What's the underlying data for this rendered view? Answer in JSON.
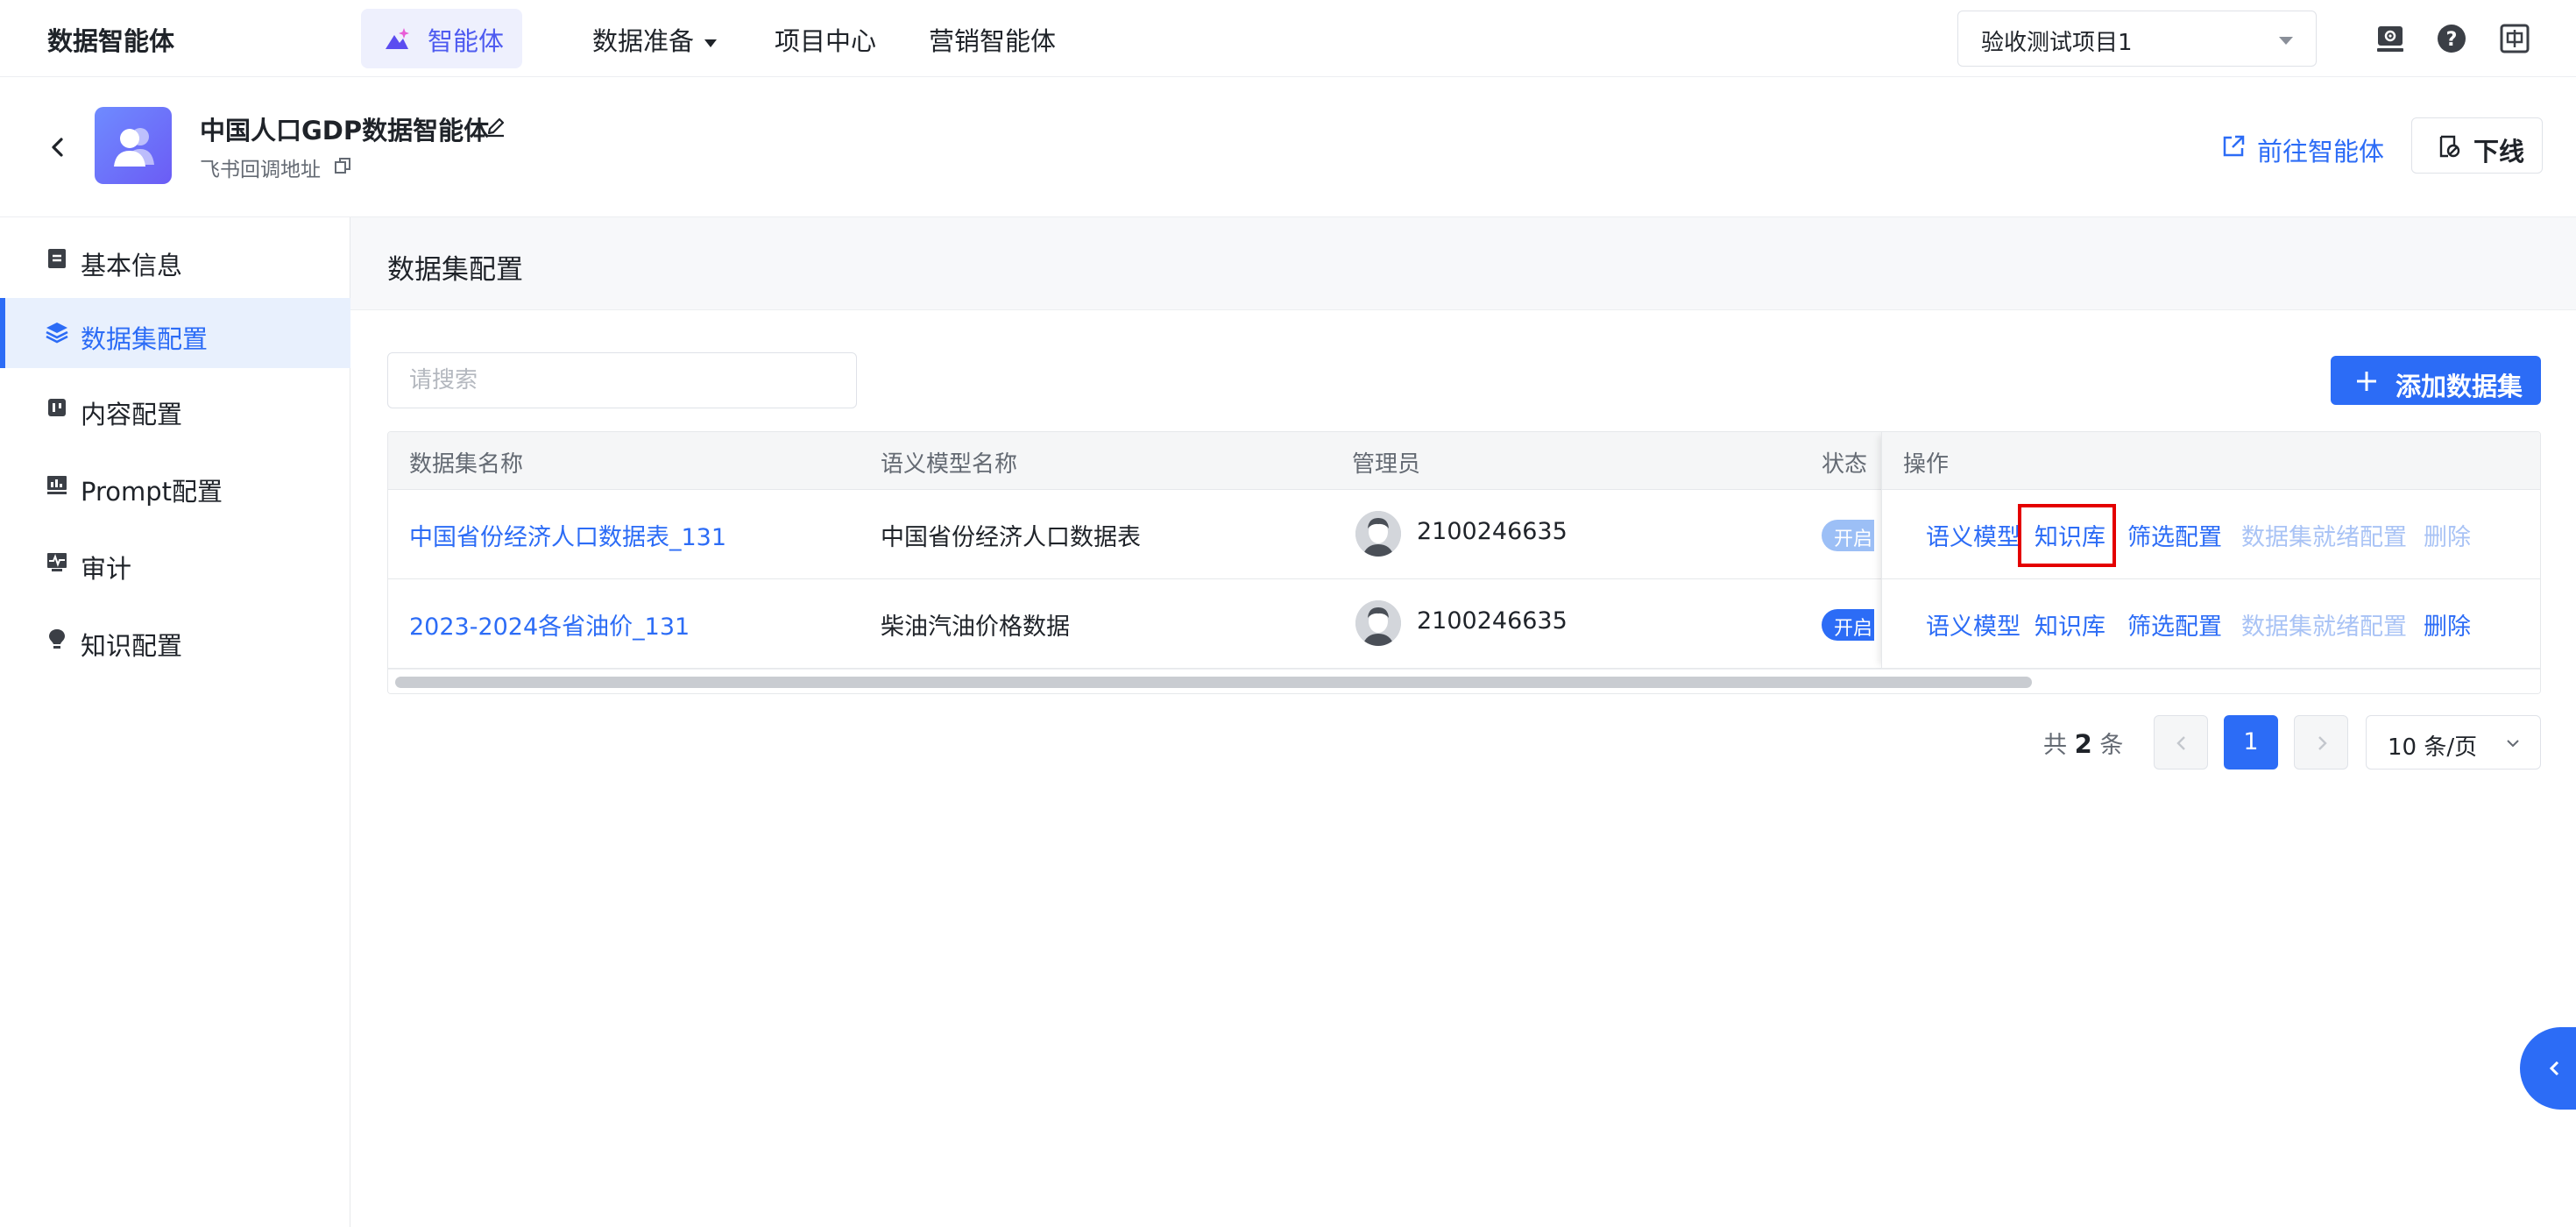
{
  "topbar": {
    "brand": "数据智能体",
    "nav": [
      {
        "label": "智能体"
      },
      {
        "label": "数据准备"
      },
      {
        "label": "项目中心"
      },
      {
        "label": "营销智能体"
      }
    ],
    "project": "验收测试项目1"
  },
  "agent": {
    "title": "中国人口GDP数据智能体",
    "subtitle": "飞书回调地址",
    "goto_label": "前往智能体",
    "offline_label": "下线"
  },
  "sidebar": {
    "items": [
      {
        "label": "基本信息",
        "icon": "document-icon"
      },
      {
        "label": "数据集配置",
        "icon": "layers-icon"
      },
      {
        "label": "内容配置",
        "icon": "content-icon"
      },
      {
        "label": "Prompt配置",
        "icon": "chart-icon"
      },
      {
        "label": "审计",
        "icon": "pulse-icon"
      },
      {
        "label": "知识配置",
        "icon": "bulb-icon"
      }
    ],
    "active_index": 1
  },
  "main": {
    "section_title": "数据集配置",
    "search_placeholder": "请搜索",
    "add_button": "添加数据集"
  },
  "table": {
    "columns": [
      "数据集名称",
      "语义模型名称",
      "管理员",
      "状态",
      "操作"
    ],
    "rows": [
      {
        "name": "中国省份经济人口数据表_131",
        "model": "中国省份经济人口数据表",
        "admin": "2100246635",
        "status": "开启",
        "status_enabled": false
      },
      {
        "name": "2023-2024各省油价_131",
        "model": "柴油汽油价格数据",
        "admin": "2100246635",
        "status": "开启",
        "status_enabled": true
      }
    ],
    "actions": [
      "语义模型",
      "知识库",
      "筛选配置",
      "数据集就绪配置",
      "删除"
    ]
  },
  "pagination": {
    "total_prefix": "共",
    "total": "2",
    "total_suffix": "条",
    "current_page": "1",
    "page_size": "10 条/页"
  },
  "watermark": "2100246635",
  "colors": {
    "primary": "#2c6cf6",
    "highlight": "#e40000",
    "active_nav": "#4e5bf0"
  }
}
